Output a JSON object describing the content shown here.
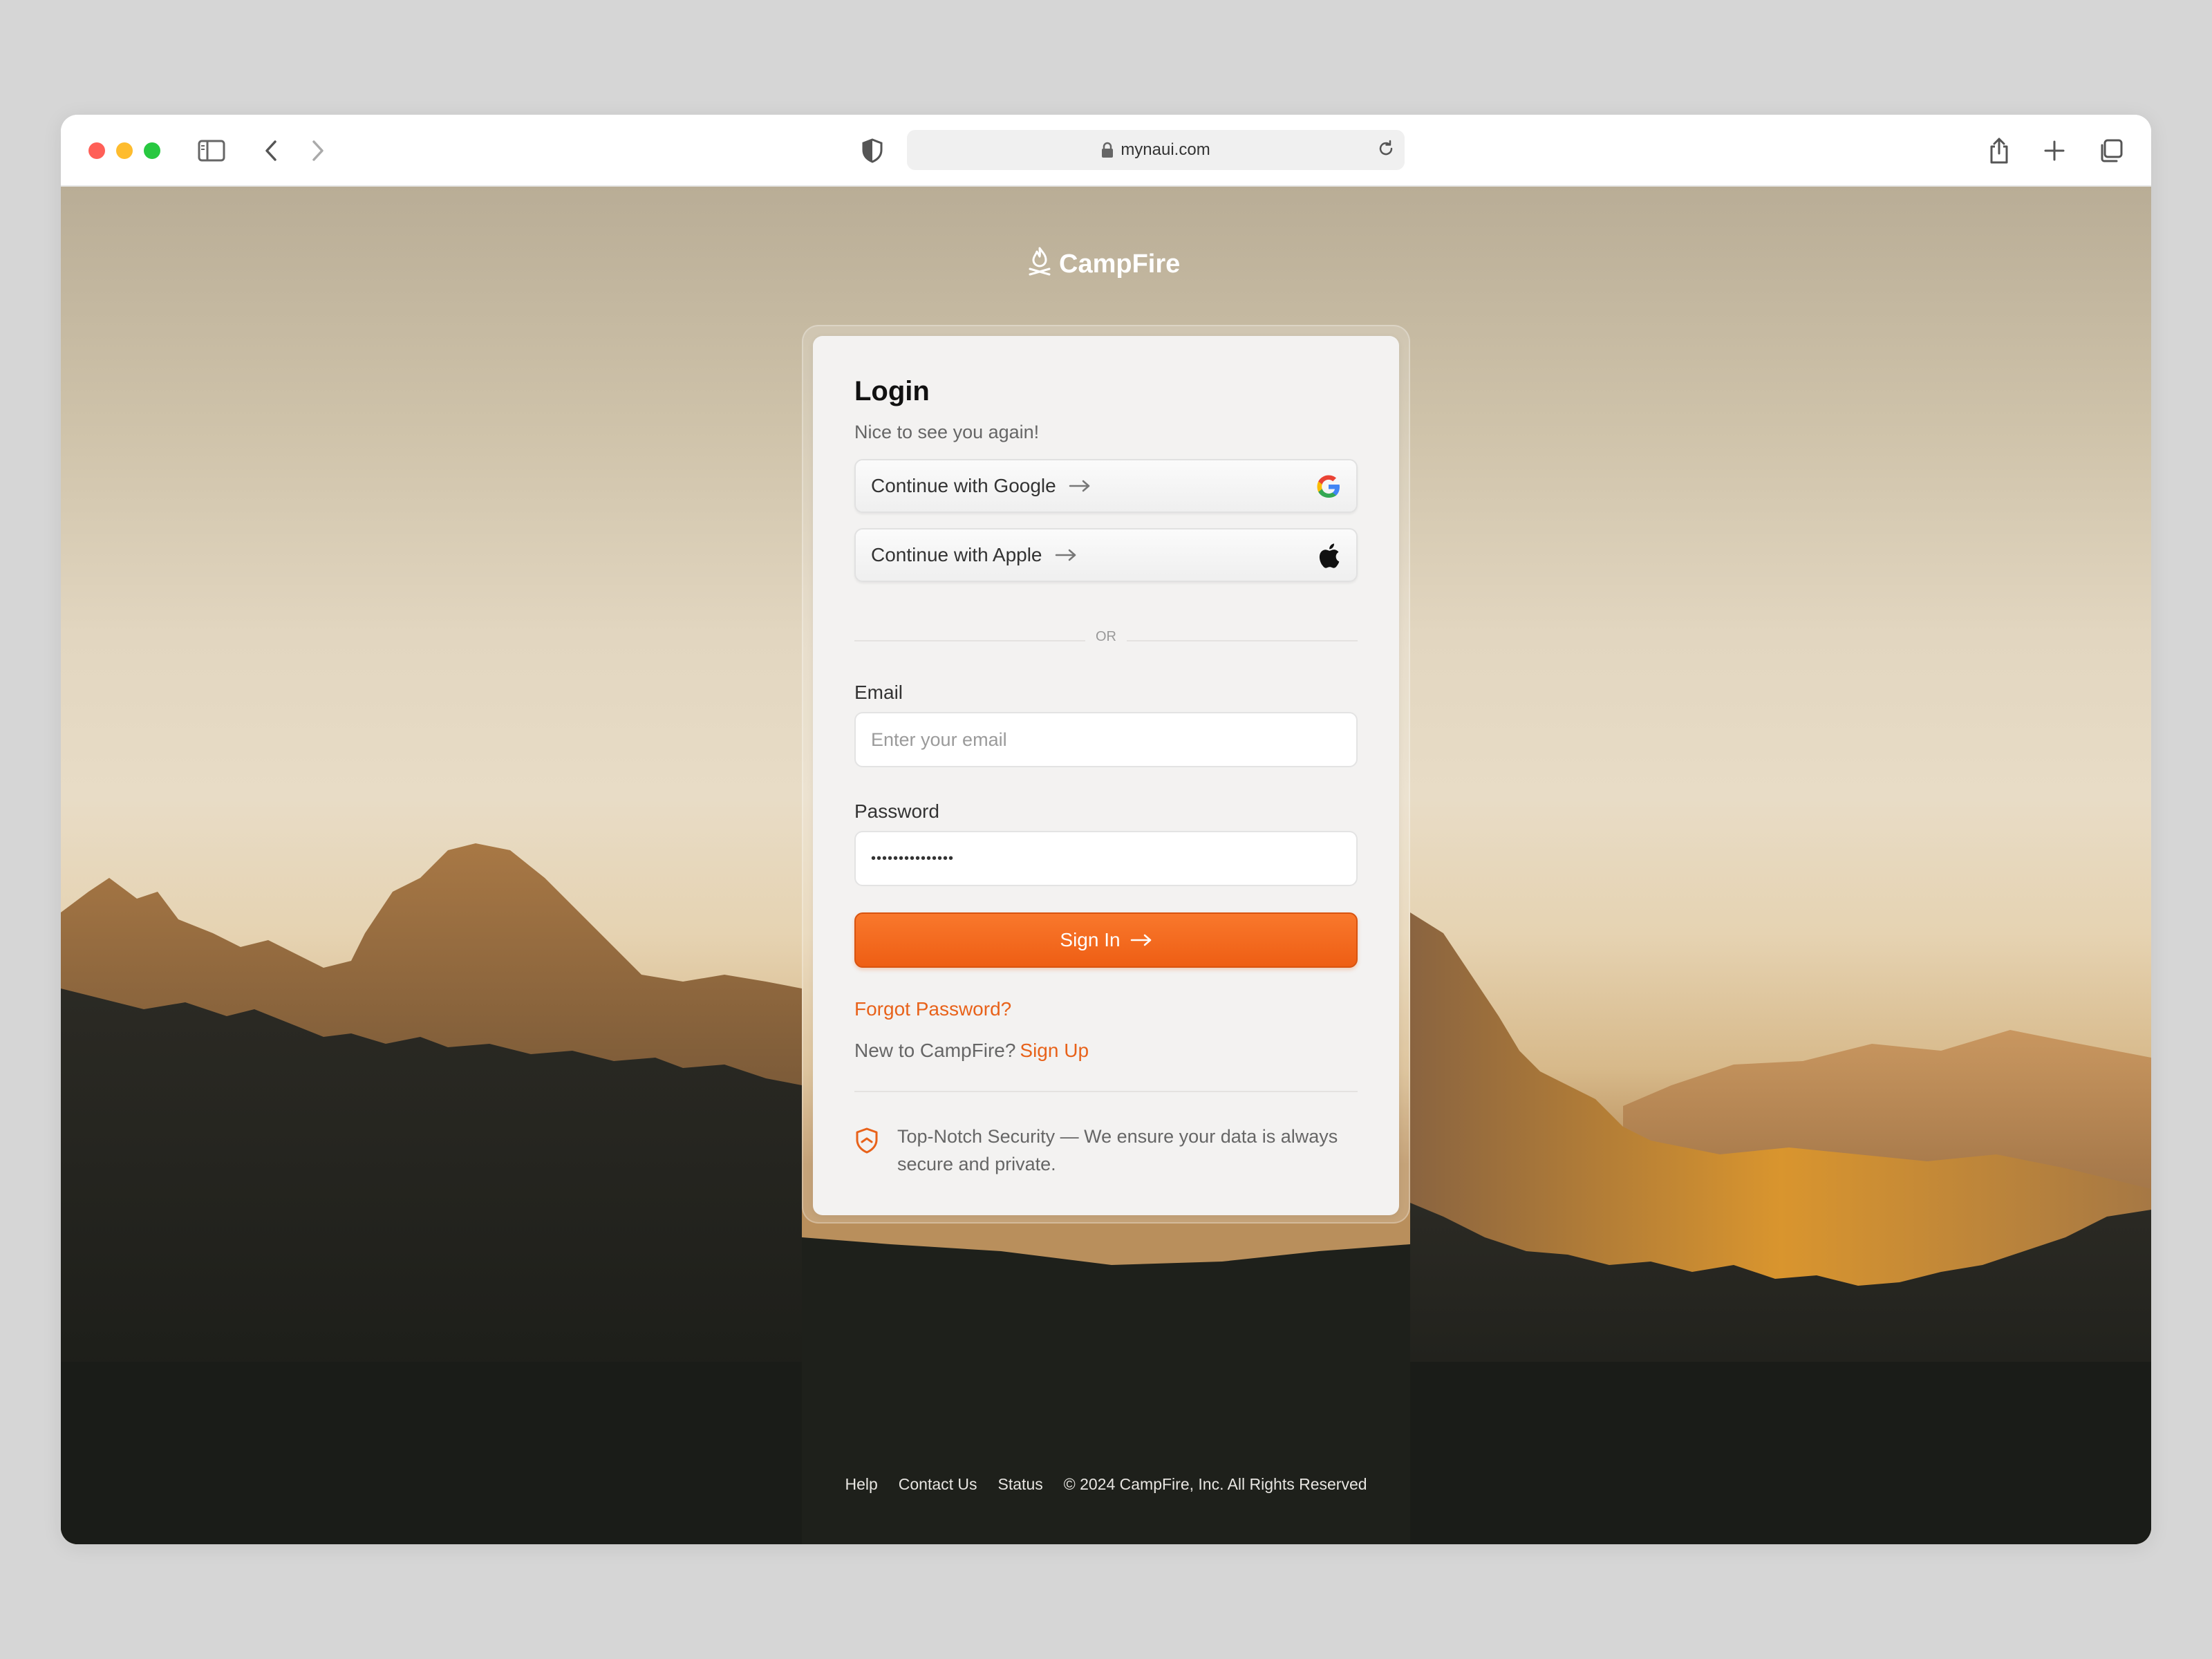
{
  "browser": {
    "url": "mynaui.com",
    "icons": [
      "sidebar-icon",
      "back-icon",
      "forward-icon",
      "shield-icon",
      "lock-icon",
      "reload-icon",
      "share-icon",
      "new-tab-icon",
      "tabs-icon"
    ]
  },
  "brand": {
    "name": "CampFire",
    "icon": "campfire-icon"
  },
  "login": {
    "title": "Login",
    "subtitle": "Nice to see you again!",
    "google_label": "Continue with Google",
    "apple_label": "Continue with Apple",
    "or_label": "OR",
    "email_label": "Email",
    "email_placeholder": "Enter your email",
    "password_label": "Password",
    "password_value": "•••••••••••••••",
    "signin_label": "Sign In",
    "forgot_label": "Forgot Password?",
    "new_to_label": "New to CampFire?",
    "signup_label": "Sign Up",
    "security_text": "Top-Notch Security — We ensure your data is always secure and private."
  },
  "footer": {
    "help": "Help",
    "contact": "Contact Us",
    "status": "Status",
    "copyright": "© 2024 CampFire, Inc. All Rights Reserved"
  },
  "colors": {
    "accent": "#ee5e14",
    "link": "#e8621a",
    "card": "#f3f2f1",
    "mountain_dark": "#1f211d"
  }
}
